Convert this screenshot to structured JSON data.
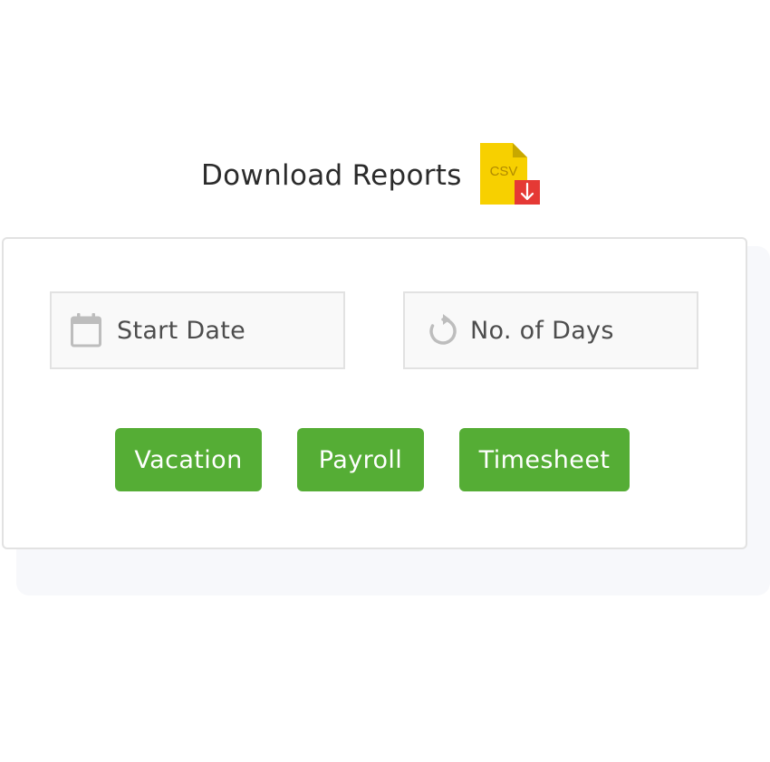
{
  "header": {
    "title": "Download Reports",
    "file_badge": {
      "text": "CSV",
      "icon": "csv-download-icon",
      "badge_color": "#f7d000",
      "arrow_color": "#e53935"
    }
  },
  "filters": {
    "start_date": {
      "placeholder": "Start Date",
      "icon": "calendar-icon"
    },
    "num_days": {
      "placeholder": "No. of Days",
      "icon": "refresh-icon"
    }
  },
  "actions": {
    "vacation_label": "Vacation",
    "payroll_label": "Payroll",
    "timesheet_label": "Timesheet",
    "button_color": "#55ad35"
  }
}
